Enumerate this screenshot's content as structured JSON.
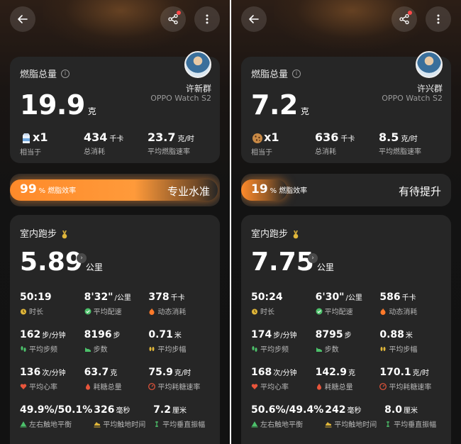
{
  "panels": [
    {
      "summary": {
        "title": "燃脂总量",
        "user_name": "许新群",
        "device": "OPPO Watch S2",
        "fat_value": "19.9",
        "fat_unit": "克",
        "equiv_value": "x1",
        "equiv_label": "相当于",
        "equiv_icon": "milk-carton-icon",
        "calories_value": "434",
        "calories_unit": "千卡",
        "calories_label": "总消耗",
        "rate_value": "23.7",
        "rate_unit": "克/时",
        "rate_label": "平均燃脂速率"
      },
      "efficiency": {
        "percent": "99",
        "unit": "%",
        "label": "燃脂效率",
        "fill": 0.99,
        "tag": "专业水准"
      },
      "workout": {
        "title": "室内跑步",
        "distance": "5.89",
        "distance_unit": "公里",
        "rows": [
          [
            {
              "v": "50:19",
              "u": "",
              "l": "时长",
              "icon": "timer-icon"
            },
            {
              "v": "8'32\"",
              "u": "/公里",
              "l": "平均配速",
              "icon": "pace-check-icon"
            },
            {
              "v": "378",
              "u": "千卡",
              "l": "动态消耗",
              "icon": "flame-icon"
            }
          ],
          [
            {
              "v": "162",
              "u": "步/分钟",
              "l": "平均步频",
              "icon": "footprints-icon"
            },
            {
              "v": "8196",
              "u": "步",
              "l": "步数",
              "icon": "shoe-icon"
            },
            {
              "v": "0.71",
              "u": "米",
              "l": "平均步幅",
              "icon": "stride-icon"
            }
          ],
          [
            {
              "v": "136",
              "u": "次/分钟",
              "l": "平均心率",
              "icon": "heart-icon"
            },
            {
              "v": "63.7",
              "u": "克",
              "l": "耗糖总量",
              "icon": "drop-icon"
            },
            {
              "v": "75.9",
              "u": "克/时",
              "l": "平均耗糖速率",
              "icon": "gauge-icon"
            }
          ],
          [
            {
              "v": "49.9%/50.1%",
              "u": "",
              "l": "左右触地平衡",
              "icon": "balance-icon"
            },
            {
              "v": "326",
              "u": "毫秒",
              "l": "平均触地时间",
              "icon": "ground-contact-icon"
            },
            {
              "v": "7.2",
              "u": "厘米",
              "l": "平均垂直振幅",
              "icon": "vertical-icon"
            }
          ]
        ]
      }
    },
    {
      "summary": {
        "title": "燃脂总量",
        "user_name": "许兴群",
        "device": "OPPO Watch S2",
        "fat_value": "7.2",
        "fat_unit": "克",
        "equiv_value": "x1",
        "equiv_label": "相当于",
        "equiv_icon": "cookie-icon",
        "calories_value": "636",
        "calories_unit": "千卡",
        "calories_label": "总消耗",
        "rate_value": "8.5",
        "rate_unit": "克/时",
        "rate_label": "平均燃脂速率"
      },
      "efficiency": {
        "percent": "19",
        "unit": "%",
        "label": "燃脂效率",
        "fill": 0.19,
        "tag": "有待提升"
      },
      "workout": {
        "title": "室内跑步",
        "distance": "7.75",
        "distance_unit": "公里",
        "rows": [
          [
            {
              "v": "50:24",
              "u": "",
              "l": "时长",
              "icon": "timer-icon"
            },
            {
              "v": "6'30\"",
              "u": "/公里",
              "l": "平均配速",
              "icon": "pace-check-icon"
            },
            {
              "v": "586",
              "u": "千卡",
              "l": "动态消耗",
              "icon": "flame-icon"
            }
          ],
          [
            {
              "v": "174",
              "u": "步/分钟",
              "l": "平均步频",
              "icon": "footprints-icon"
            },
            {
              "v": "8795",
              "u": "步",
              "l": "步数",
              "icon": "shoe-icon"
            },
            {
              "v": "0.88",
              "u": "米",
              "l": "平均步幅",
              "icon": "stride-icon"
            }
          ],
          [
            {
              "v": "168",
              "u": "次/分钟",
              "l": "平均心率",
              "icon": "heart-icon"
            },
            {
              "v": "142.9",
              "u": "克",
              "l": "耗糖总量",
              "icon": "drop-icon"
            },
            {
              "v": "170.1",
              "u": "克/时",
              "l": "平均耗糖速率",
              "icon": "gauge-icon"
            }
          ],
          [
            {
              "v": "50.6%/49.4%",
              "u": "",
              "l": "左右触地平衡",
              "icon": "balance-icon"
            },
            {
              "v": "242",
              "u": "毫秒",
              "l": "平均触地时间",
              "icon": "ground-contact-icon"
            },
            {
              "v": "8.0",
              "u": "厘米",
              "l": "平均垂直振幅",
              "icon": "vertical-icon"
            }
          ]
        ]
      }
    }
  ],
  "colors": {
    "orange": "#ff8a2a",
    "green": "#4cc06a",
    "red": "#e8553b",
    "gold": "#e0b63a"
  }
}
